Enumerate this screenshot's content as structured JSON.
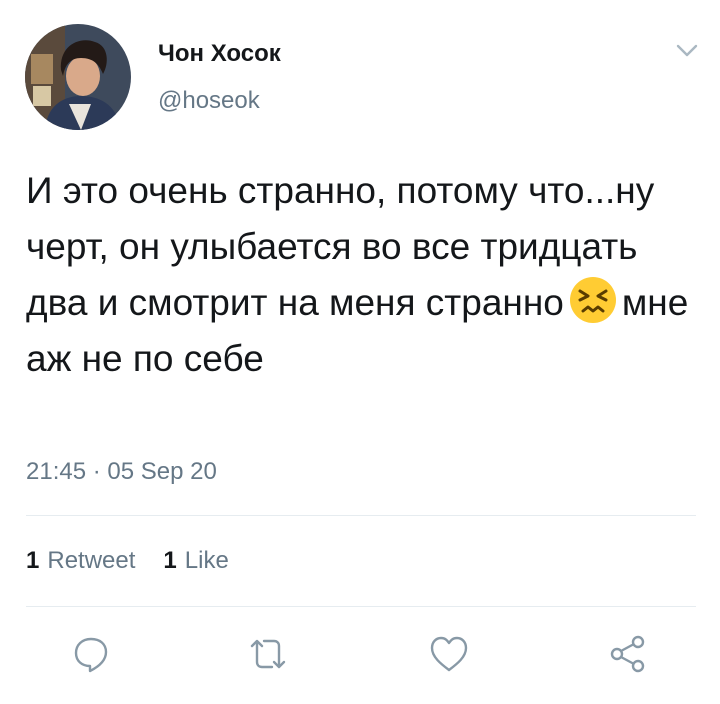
{
  "author": {
    "display_name": "Чон Хосок",
    "handle": "@hoseok",
    "avatar_icon": "profile-photo"
  },
  "tweet": {
    "text_before_emoji": "И это очень странно, потому что...ну черт, он улыбается во все тридцать два и смотрит на меня странно",
    "emoji": "persevering-face",
    "text_after_emoji": "мне аж не по себе",
    "timestamp": "21:45 · 05 Sep 20"
  },
  "stats": {
    "retweet_count": "1",
    "retweet_label": "Retweet",
    "like_count": "1",
    "like_label": "Like"
  },
  "actions": [
    {
      "name": "reply",
      "icon": "reply-icon"
    },
    {
      "name": "retweet",
      "icon": "retweet-icon"
    },
    {
      "name": "like",
      "icon": "heart-icon"
    },
    {
      "name": "share",
      "icon": "share-icon"
    }
  ],
  "colors": {
    "text": "#14171a",
    "secondary": "#657786",
    "divider": "#e6ecf0",
    "icon": "#8899a6"
  }
}
